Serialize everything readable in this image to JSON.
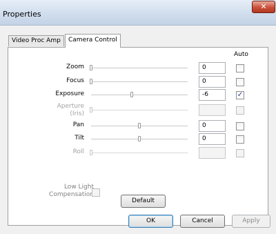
{
  "window": {
    "title": "Properties",
    "close_glyph": "✕"
  },
  "tabs": [
    {
      "label": "Video Proc Amp",
      "active": false
    },
    {
      "label": "Camera Control",
      "active": true
    }
  ],
  "panel": {
    "auto_header": "Auto",
    "rows": [
      {
        "label": "Zoom",
        "value": "0",
        "slider_fraction": 0.0,
        "auto_checked": false,
        "enabled": true
      },
      {
        "label": "Focus",
        "value": "0",
        "slider_fraction": 0.0,
        "auto_checked": false,
        "enabled": true
      },
      {
        "label": "Exposure",
        "value": "-6",
        "slider_fraction": 0.42,
        "auto_checked": true,
        "enabled": true
      },
      {
        "label": "Aperture\n(Iris)",
        "value": "",
        "slider_fraction": 0.0,
        "auto_checked": false,
        "enabled": false
      },
      {
        "label": "Pan",
        "value": "0",
        "slider_fraction": 0.5,
        "auto_checked": false,
        "enabled": true
      },
      {
        "label": "Tilt",
        "value": "0",
        "slider_fraction": 0.5,
        "auto_checked": false,
        "enabled": true
      },
      {
        "label": "Roll",
        "value": "",
        "slider_fraction": 0.0,
        "auto_checked": false,
        "enabled": false
      }
    ],
    "low_light_label": "Low Light\nCompensation",
    "default_button": "Default"
  },
  "buttons": {
    "ok": "OK",
    "cancel": "Cancel",
    "apply": "Apply"
  },
  "check_glyph": "✓"
}
